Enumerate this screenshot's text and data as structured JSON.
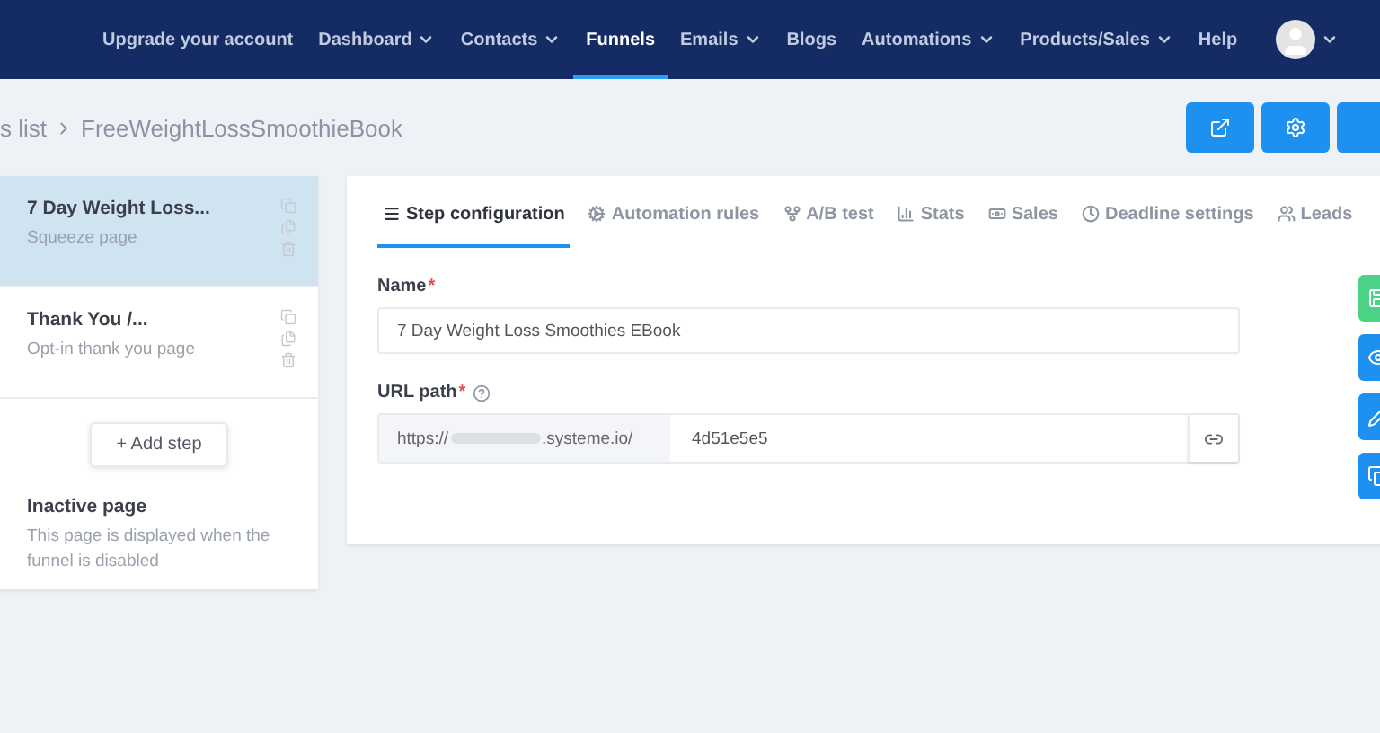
{
  "nav": {
    "items": [
      {
        "label": "Upgrade your account",
        "dropdown": false,
        "selected": false
      },
      {
        "label": "Dashboard",
        "dropdown": true,
        "selected": false
      },
      {
        "label": "Contacts",
        "dropdown": true,
        "selected": false
      },
      {
        "label": "Funnels",
        "dropdown": false,
        "selected": true
      },
      {
        "label": "Emails",
        "dropdown": true,
        "selected": false
      },
      {
        "label": "Blogs",
        "dropdown": false,
        "selected": false
      },
      {
        "label": "Automations",
        "dropdown": true,
        "selected": false
      },
      {
        "label": "Products/Sales",
        "dropdown": true,
        "selected": false
      },
      {
        "label": "Help",
        "dropdown": false,
        "selected": false
      }
    ]
  },
  "breadcrumb": {
    "parent": "s list",
    "current": "FreeWeightLossSmoothieBook"
  },
  "steps": [
    {
      "title": "7 Day Weight Loss...",
      "subtitle": "Squeeze page",
      "selected": true
    },
    {
      "title": "Thank You /...",
      "subtitle": "Opt-in thank you page",
      "selected": false
    }
  ],
  "add_step": "+ Add step",
  "inactive": {
    "title": "Inactive page",
    "text": "This page is displayed when the funnel is disabled"
  },
  "tabs": [
    {
      "label": "Step configuration",
      "selected": true
    },
    {
      "label": "Automation rules",
      "selected": false
    },
    {
      "label": "A/B test",
      "selected": false
    },
    {
      "label": "Stats",
      "selected": false
    },
    {
      "label": "Sales",
      "selected": false
    },
    {
      "label": "Deadline settings",
      "selected": false
    },
    {
      "label": "Leads",
      "selected": false
    }
  ],
  "form": {
    "required_mark": "*",
    "name_label": "Name",
    "name_value": "7 Day Weight Loss Smoothies EBook",
    "url_label": "URL path",
    "url_prefix_start": "https://",
    "url_prefix_end": ".systeme.io/",
    "url_value": "4d51e5e5"
  }
}
